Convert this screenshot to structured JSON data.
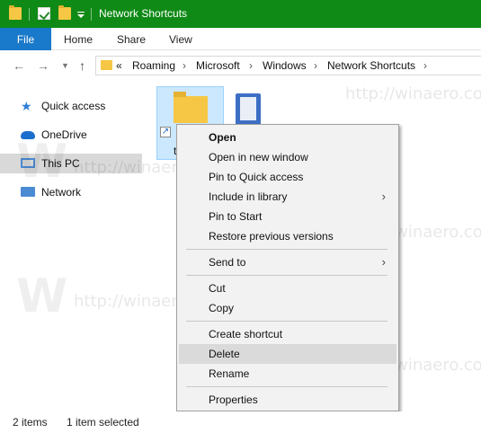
{
  "window": {
    "title": "Network Shortcuts",
    "accent_color": "#0f8a16"
  },
  "ribbon": {
    "file_tab": "File",
    "tabs": [
      "Home",
      "Share",
      "View"
    ],
    "file_tab_color": "#1979ca"
  },
  "address": {
    "overflow": "«",
    "crumbs": [
      "Roaming",
      "Microsoft",
      "Windows",
      "Network Shortcuts"
    ]
  },
  "nav_pane": {
    "items": [
      {
        "label": "Quick access",
        "icon": "star-icon"
      },
      {
        "label": "OneDrive",
        "icon": "cloud-icon"
      },
      {
        "label": "This PC",
        "icon": "computer-icon"
      },
      {
        "label": "Network",
        "icon": "network-icon"
      }
    ]
  },
  "files": {
    "selected_item_label": "t"
  },
  "context_menu": {
    "items": [
      "Open",
      "Open in new window",
      "Pin to Quick access",
      "Include in library",
      "Pin to Start",
      "Restore previous versions",
      "Send to",
      "Cut",
      "Copy",
      "Create shortcut",
      "Delete",
      "Rename",
      "Properties"
    ],
    "submenu_arrow": "›"
  },
  "status": {
    "item_count": "2 items",
    "selection": "1 item selected"
  },
  "watermark": {
    "text": "http://winaero.com",
    "letter": "W"
  }
}
